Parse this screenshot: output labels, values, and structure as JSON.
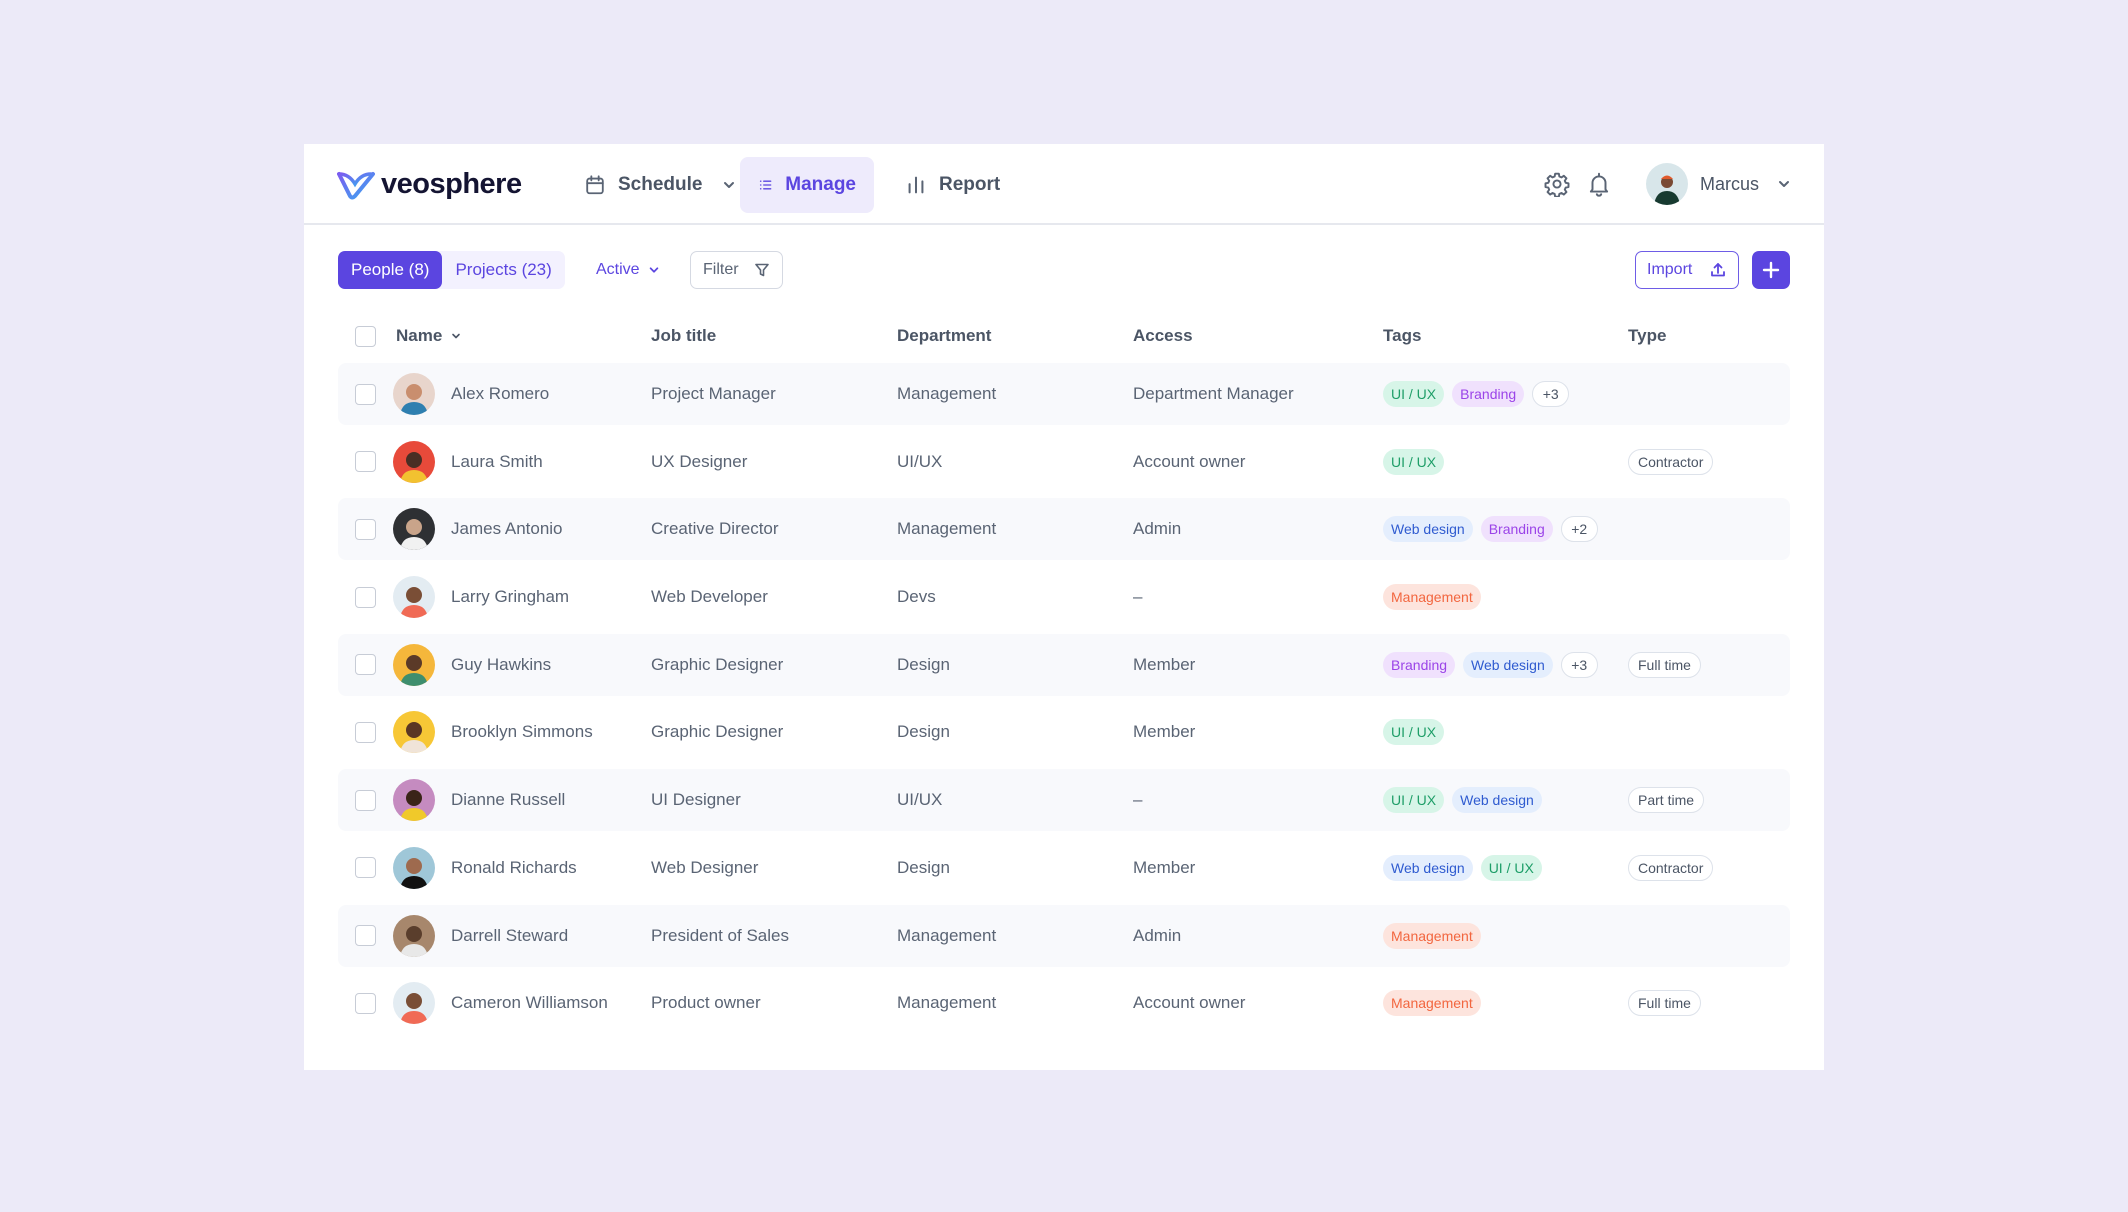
{
  "app": {
    "brand": "veosphere",
    "colors": {
      "accent": "#5B45E0",
      "background": "#ECEAF8"
    }
  },
  "nav": {
    "schedule": "Schedule",
    "manage": "Manage",
    "report": "Report"
  },
  "user": {
    "name": "Marcus"
  },
  "toolbar": {
    "people": "People (8)",
    "projects": "Projects (23)",
    "status": "Active",
    "filter": "Filter",
    "import": "Import"
  },
  "table": {
    "columns": [
      "Name",
      "Job title",
      "Department",
      "Access",
      "Tags",
      "Type"
    ],
    "rows": [
      {
        "name": "Alex Romero",
        "job": "Project Manager",
        "department": "Management",
        "access": "Department Manager",
        "tags": [
          "UI / UX",
          "Branding"
        ],
        "more": "+3",
        "type": ""
      },
      {
        "name": "Laura Smith",
        "job": "UX Designer",
        "department": "UI/UX",
        "access": "Account owner",
        "tags": [
          "UI / UX"
        ],
        "more": "",
        "type": "Contractor"
      },
      {
        "name": "James Antonio",
        "job": "Creative Director",
        "department": "Management",
        "access": "Admin",
        "tags": [
          "Web design",
          "Branding"
        ],
        "more": "+2",
        "type": ""
      },
      {
        "name": "Larry Gringham",
        "job": "Web Developer",
        "department": "Devs",
        "access": "–",
        "tags": [
          "Management"
        ],
        "more": "",
        "type": ""
      },
      {
        "name": "Guy Hawkins",
        "job": "Graphic Designer",
        "department": "Design",
        "access": "Member",
        "tags": [
          "Branding",
          "Web design"
        ],
        "more": "+3",
        "type": "Full time"
      },
      {
        "name": "Brooklyn Simmons",
        "job": "Graphic Designer",
        "department": "Design",
        "access": "Member",
        "tags": [
          "UI / UX"
        ],
        "more": "",
        "type": ""
      },
      {
        "name": "Dianne Russell",
        "job": "UI Designer",
        "department": "UI/UX",
        "access": "–",
        "tags": [
          "UI / UX",
          "Web design"
        ],
        "more": "",
        "type": "Part time"
      },
      {
        "name": "Ronald Richards",
        "job": "Web Designer",
        "department": "Design",
        "access": "Member",
        "tags": [
          "Web design",
          "UI / UX"
        ],
        "more": "",
        "type": "Contractor"
      },
      {
        "name": "Darrell Steward",
        "job": "President of Sales",
        "department": "Management",
        "access": "Admin",
        "tags": [
          "Management"
        ],
        "more": "",
        "type": ""
      },
      {
        "name": "Cameron Williamson",
        "job": "Product owner",
        "department": "Management",
        "access": "Account owner",
        "tags": [
          "Management"
        ],
        "more": "",
        "type": "Full time"
      }
    ]
  },
  "tag_colors": {
    "UI / UX": "uiux",
    "Branding": "branding",
    "Web design": "webdesign",
    "Management": "management"
  }
}
